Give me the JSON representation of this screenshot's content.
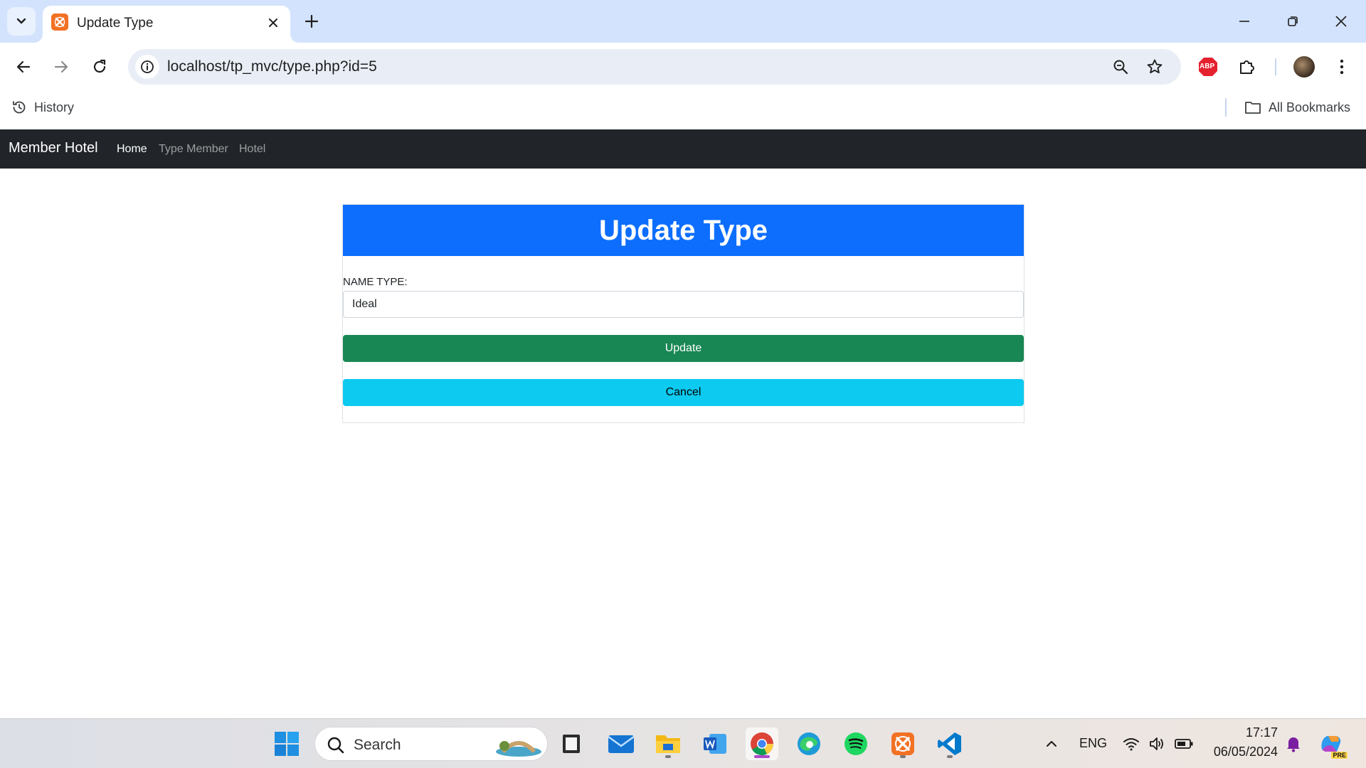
{
  "browser": {
    "tab_title": "Update Type",
    "url": "localhost/tp_mvc/type.php?id=5",
    "bookmarks": {
      "history_label": "History",
      "all_bookmarks_label": "All Bookmarks"
    },
    "extension_badge": "ABP"
  },
  "page": {
    "brand": "Member Hotel",
    "nav": [
      {
        "label": "Home",
        "active": true
      },
      {
        "label": "Type Member",
        "active": false
      },
      {
        "label": "Hotel",
        "active": false
      }
    ],
    "card_title": "Update Type",
    "form": {
      "name_label": "NAME TYPE:",
      "name_value": "Ideal",
      "update_label": "Update",
      "cancel_label": "Cancel"
    },
    "colors": {
      "header": "#0d6efd",
      "update": "#198754",
      "cancel": "#0dcaf0",
      "navbar": "#212529"
    }
  },
  "taskbar": {
    "search_placeholder": "Search",
    "language": "ENG",
    "time": "17:17",
    "date": "06/05/2024",
    "copilot_badge": "PRE",
    "apps": [
      "start-icon",
      "file-explorer-icon",
      "mail-icon",
      "folder-icon",
      "word-icon",
      "chrome-icon",
      "edge-icon",
      "spotify-icon",
      "xampp-icon",
      "vscode-icon"
    ]
  }
}
